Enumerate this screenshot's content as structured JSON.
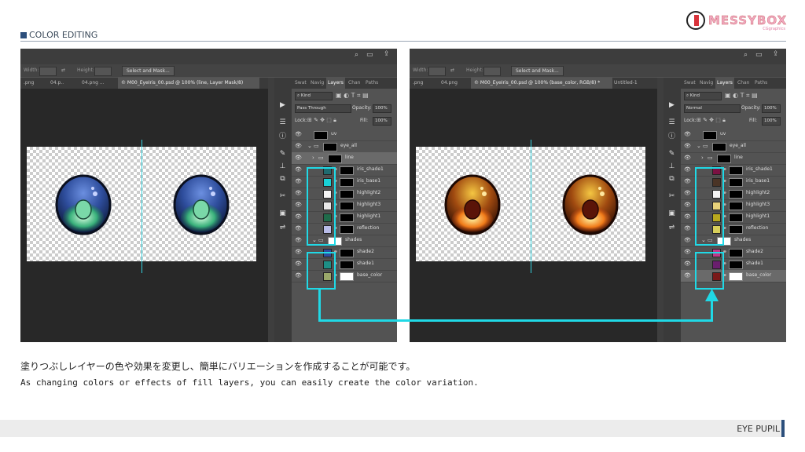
{
  "header": {
    "section_title": "COLOR EDITING",
    "logo_text": "MESSYBOX",
    "logo_sub": "CGgraphics"
  },
  "left_window": {
    "options": {
      "width_label": "Width:",
      "height_label": "Height:",
      "select_mask": "Select and Mask..."
    },
    "tabs": [
      ".png",
      "04.p..",
      "04.png ...",
      "© M00_EyeIris_00.psd @ 100% (line, Layer Mask/8)"
    ],
    "panel_tabs": [
      "Swat",
      "Navig",
      "Layers",
      "Chan",
      "Paths"
    ],
    "filter_kind": "Kind",
    "blend_mode": "Pass Through",
    "opacity_label": "Opacity:",
    "opacity_value": "100%",
    "lock_label": "Lock:",
    "fill_label": "Fill:",
    "fill_value": "100%",
    "layers": [
      {
        "name": "uv",
        "swatch": ""
      },
      {
        "name": "eye_all",
        "swatch": ""
      },
      {
        "name": "line",
        "swatch": ""
      },
      {
        "name": "iris_shade1",
        "swatch": "#1f6b70"
      },
      {
        "name": "iris_base1",
        "swatch": "#19d1d6"
      },
      {
        "name": "highlight2",
        "swatch": "#f4f4f4"
      },
      {
        "name": "highlight3",
        "swatch": "#e8e8e8"
      },
      {
        "name": "highlight1",
        "swatch": "#1f6b4a"
      },
      {
        "name": "reflection",
        "swatch": "#b8bce8"
      },
      {
        "name": "shades",
        "swatch": ""
      },
      {
        "name": "shade2",
        "swatch": "#2f4c9e"
      },
      {
        "name": "shade1",
        "swatch": "#1d8f86"
      },
      {
        "name": "base_color",
        "swatch": "#9aa86a"
      }
    ]
  },
  "right_window": {
    "options": {
      "width_label": "Width:",
      "height_label": "Height:",
      "select_mask": "Select and Mask..."
    },
    "tabs": [
      ".png",
      "04.png",
      "© M00_EyeIris_00.psd @ 100% (base_color, RGB/8) *",
      "Untitled-1"
    ],
    "panel_tabs": [
      "Swat",
      "Navig",
      "Layers",
      "Chan",
      "Paths"
    ],
    "filter_kind": "Kind",
    "blend_mode": "Normal",
    "opacity_label": "Opacity:",
    "opacity_value": "100%",
    "lock_label": "Lock:",
    "fill_label": "Fill:",
    "fill_value": "100%",
    "layers": [
      {
        "name": "uv",
        "swatch": ""
      },
      {
        "name": "eye_all",
        "swatch": ""
      },
      {
        "name": "line",
        "swatch": ""
      },
      {
        "name": "iris_shade1",
        "swatch": "#7a1142"
      },
      {
        "name": "iris_base1",
        "swatch": "#4a3426"
      },
      {
        "name": "highlight2",
        "swatch": "#f4f4f4"
      },
      {
        "name": "highlight3",
        "swatch": "#e8d27a"
      },
      {
        "name": "highlight1",
        "swatch": "#b8a81e"
      },
      {
        "name": "reflection",
        "swatch": "#d8cf5a"
      },
      {
        "name": "shades",
        "swatch": ""
      },
      {
        "name": "shade2",
        "swatch": "#c0388a"
      },
      {
        "name": "shade1",
        "swatch": "#6a1e6e"
      },
      {
        "name": "base_color",
        "swatch": "#7a1a1a"
      }
    ]
  },
  "captions": {
    "japanese": "塗りつぶしレイヤーの色や効果を変更し、簡単にバリエーションを作成することが可能です。",
    "english": "As changing colors or effects of fill layers, you can easily create the color variation."
  },
  "footer": {
    "label": "EYE PUPIL"
  },
  "colors": {
    "accent": "#20d9e6",
    "brand": "#2c4f7c"
  }
}
